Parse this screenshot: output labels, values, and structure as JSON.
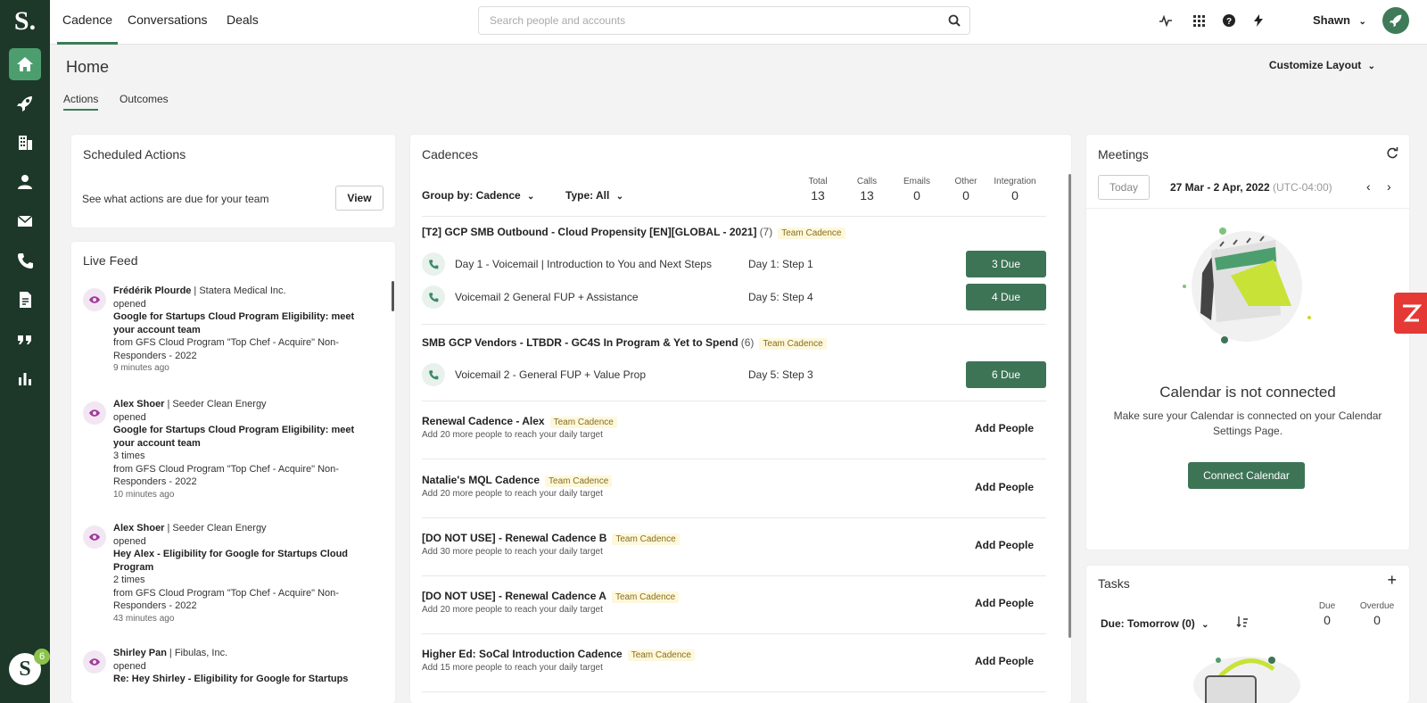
{
  "app": {
    "logo": "S.",
    "user_initial": "S",
    "user_badge": "6"
  },
  "topnav": {
    "tabs": [
      "Cadence",
      "Conversations",
      "Deals"
    ],
    "search_placeholder": "Search people and accounts",
    "user": "Shawn"
  },
  "page": {
    "title": "Home",
    "customize": "Customize Layout",
    "subtabs": [
      "Actions",
      "Outcomes"
    ]
  },
  "scheduled": {
    "title": "Scheduled Actions",
    "desc": "See what actions are due for your team",
    "view": "View"
  },
  "livefeed": {
    "title": "Live Feed",
    "items": [
      {
        "name": "Frédérik Plourde",
        "company": "| Statera Medical Inc.",
        "action": "opened",
        "subject": "Google for Startups Cloud Program Eligibility: meet your account team",
        "count": "",
        "from": "from GFS Cloud Program \"Top Chef - Acquire\" Non-Responders - 2022",
        "time": "9 minutes ago"
      },
      {
        "name": "Alex Shoer",
        "company": "| Seeder Clean Energy",
        "action": "opened",
        "subject": "Google for Startups Cloud Program Eligibility: meet your account team",
        "count": "3 times",
        "from": "from GFS Cloud Program \"Top Chef - Acquire\" Non-Responders - 2022",
        "time": "10 minutes ago"
      },
      {
        "name": "Alex Shoer",
        "company": "| Seeder Clean Energy",
        "action": "opened",
        "subject": "Hey Alex - Eligibility for Google for Startups Cloud Program",
        "count": "2 times",
        "from": "from GFS Cloud Program \"Top Chef - Acquire\" Non-Responders - 2022",
        "time": "43 minutes ago"
      },
      {
        "name": "Shirley Pan",
        "company": "| Fibulas, Inc.",
        "action": "opened",
        "subject": "Re: Hey Shirley - Eligibility for Google for Startups",
        "count": "",
        "from": "",
        "time": ""
      }
    ]
  },
  "cadences": {
    "title": "Cadences",
    "group_by": "Group by: Cadence",
    "type": "Type: All",
    "stats": [
      {
        "label": "Total",
        "value": "13"
      },
      {
        "label": "Calls",
        "value": "13"
      },
      {
        "label": "Emails",
        "value": "0"
      },
      {
        "label": "Other",
        "value": "0"
      },
      {
        "label": "Integration",
        "value": "0"
      }
    ],
    "team_badge": "Team Cadence",
    "groups": [
      {
        "name": "[T2] GCP SMB Outbound - Cloud Propensity [EN][GLOBAL - 2021]",
        "count": "(7)",
        "steps": [
          {
            "name": "Day 1 - Voicemail | Introduction to You and Next Steps",
            "day": "Day 1: Step 1",
            "due": "3 Due"
          },
          {
            "name": "Voicemail 2 General FUP + Assistance",
            "day": "Day 5: Step 4",
            "due": "4 Due"
          }
        ]
      },
      {
        "name": "SMB GCP Vendors - LTBDR - GC4S In Program & Yet to Spend",
        "count": "(6)",
        "steps": [
          {
            "name": "Voicemail 2 - General FUP + Value Prop",
            "day": "Day 5: Step 3",
            "due": "6 Due"
          }
        ]
      }
    ],
    "add_label": "Add People",
    "targets": [
      {
        "name": "Renewal Cadence - Alex",
        "sub": "Add 20 more people to reach your daily target"
      },
      {
        "name": "Natalie's MQL Cadence",
        "sub": "Add 20 more people to reach your daily target"
      },
      {
        "name": "[DO NOT USE] - Renewal Cadence B",
        "sub": "Add 30 more people to reach your daily target"
      },
      {
        "name": "[DO NOT USE] - Renewal Cadence A",
        "sub": "Add 20 more people to reach your daily target"
      },
      {
        "name": "Higher Ed: SoCal Introduction Cadence",
        "sub": "Add 15 more people to reach your daily target"
      }
    ]
  },
  "meetings": {
    "title": "Meetings",
    "today": "Today",
    "range": "27 Mar - 2 Apr, 2022",
    "tz": "(UTC-04:00)",
    "not_connected": "Calendar is not connected",
    "desc": "Make sure your Calendar is connected on your Calendar Settings Page.",
    "connect": "Connect Calendar"
  },
  "tasks": {
    "title": "Tasks",
    "add": "+",
    "filter": "Due: Tomorrow (0)",
    "due_label": "Due",
    "due_value": "0",
    "overdue_label": "Overdue",
    "overdue_value": "0"
  },
  "colors": {
    "sidebar": "#1d3829",
    "accent": "#3d7456",
    "active_nav": "#4d9e6e",
    "badge_bg": "#fdf8dc"
  }
}
